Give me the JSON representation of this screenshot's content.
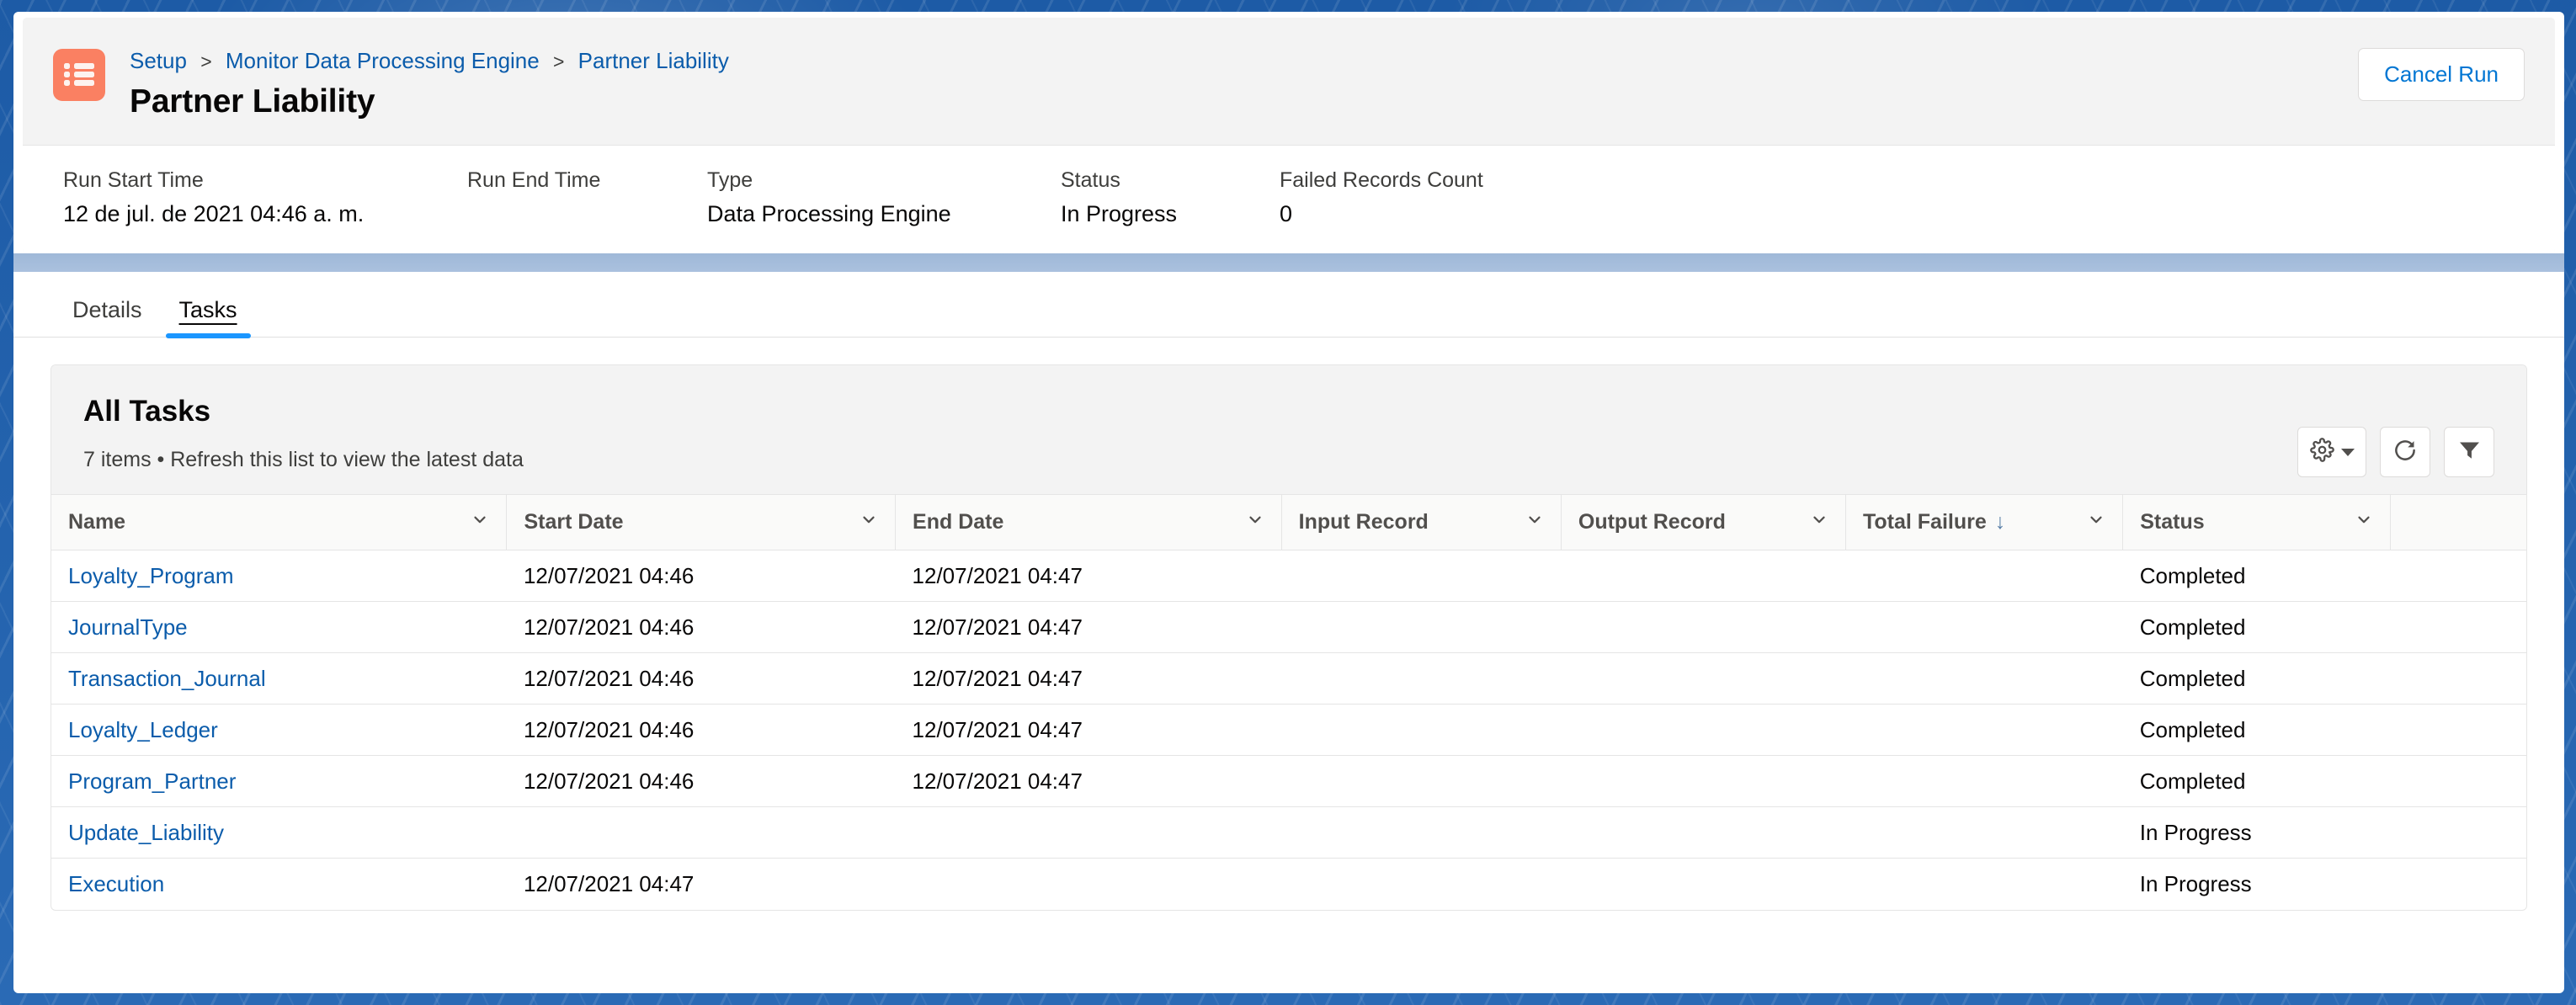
{
  "header": {
    "app_icon": "list-icon",
    "icon_color": "#fa8062",
    "breadcrumb": [
      {
        "label": "Setup",
        "link": true
      },
      {
        "label": "Monitor Data Processing Engine",
        "link": true
      },
      {
        "label": "Partner Liability",
        "link": true
      }
    ],
    "breadcrumb_separator": ">",
    "title": "Partner Liability",
    "cancel_run_label": "Cancel Run",
    "fields": [
      {
        "label": "Run Start Time",
        "value": "12 de jul. de 2021 04:46 a. m."
      },
      {
        "label": "Run End Time",
        "value": ""
      },
      {
        "label": "Type",
        "value": "Data Processing Engine"
      },
      {
        "label": "Status",
        "value": "In Progress"
      },
      {
        "label": "Failed Records Count",
        "value": "0"
      }
    ]
  },
  "tabs": [
    {
      "label": "Details",
      "active": false
    },
    {
      "label": "Tasks",
      "active": true
    }
  ],
  "list": {
    "title": "All Tasks",
    "meta": "7 items • Refresh this list to view the latest data",
    "tools": [
      {
        "name": "list-settings-button",
        "icon": "gear-icon",
        "has_caret": true
      },
      {
        "name": "refresh-button",
        "icon": "refresh-icon",
        "has_caret": false
      },
      {
        "name": "filter-button",
        "icon": "filter-icon",
        "has_caret": false
      }
    ],
    "columns": [
      {
        "label": "Name",
        "sorted": false
      },
      {
        "label": "Start Date",
        "sorted": false
      },
      {
        "label": "End Date",
        "sorted": false
      },
      {
        "label": "Input Record",
        "sorted": false
      },
      {
        "label": "Output Record",
        "sorted": false
      },
      {
        "label": "Total Failure",
        "sorted": true,
        "sort_direction": "desc",
        "sort_glyph": "↓"
      },
      {
        "label": "Status",
        "sorted": false
      },
      {
        "label": "",
        "sorted": false
      }
    ],
    "rows": [
      {
        "name": "Loyalty_Program",
        "start_date": "12/07/2021 04:46",
        "end_date": "12/07/2021 04:47",
        "input_record": "",
        "output_record": "",
        "total_failure": "",
        "status": "Completed"
      },
      {
        "name": "JournalType",
        "start_date": "12/07/2021 04:46",
        "end_date": "12/07/2021 04:47",
        "input_record": "",
        "output_record": "",
        "total_failure": "",
        "status": "Completed"
      },
      {
        "name": "Transaction_Journal",
        "start_date": "12/07/2021 04:46",
        "end_date": "12/07/2021 04:47",
        "input_record": "",
        "output_record": "",
        "total_failure": "",
        "status": "Completed"
      },
      {
        "name": "Loyalty_Ledger",
        "start_date": "12/07/2021 04:46",
        "end_date": "12/07/2021 04:47",
        "input_record": "",
        "output_record": "",
        "total_failure": "",
        "status": "Completed"
      },
      {
        "name": "Program_Partner",
        "start_date": "12/07/2021 04:46",
        "end_date": "12/07/2021 04:47",
        "input_record": "",
        "output_record": "",
        "total_failure": "",
        "status": "Completed"
      },
      {
        "name": "Update_Liability",
        "start_date": "",
        "end_date": "",
        "input_record": "",
        "output_record": "",
        "total_failure": "",
        "status": "In Progress"
      },
      {
        "name": "Execution",
        "start_date": "12/07/2021 04:47",
        "end_date": "",
        "input_record": "",
        "output_record": "",
        "total_failure": "",
        "status": "In Progress"
      }
    ]
  },
  "colors": {
    "link": "#0b5cab",
    "brand": "#1b96ff",
    "icon_accent": "#fa8062",
    "chrome_blue": "#1d5ba6"
  }
}
